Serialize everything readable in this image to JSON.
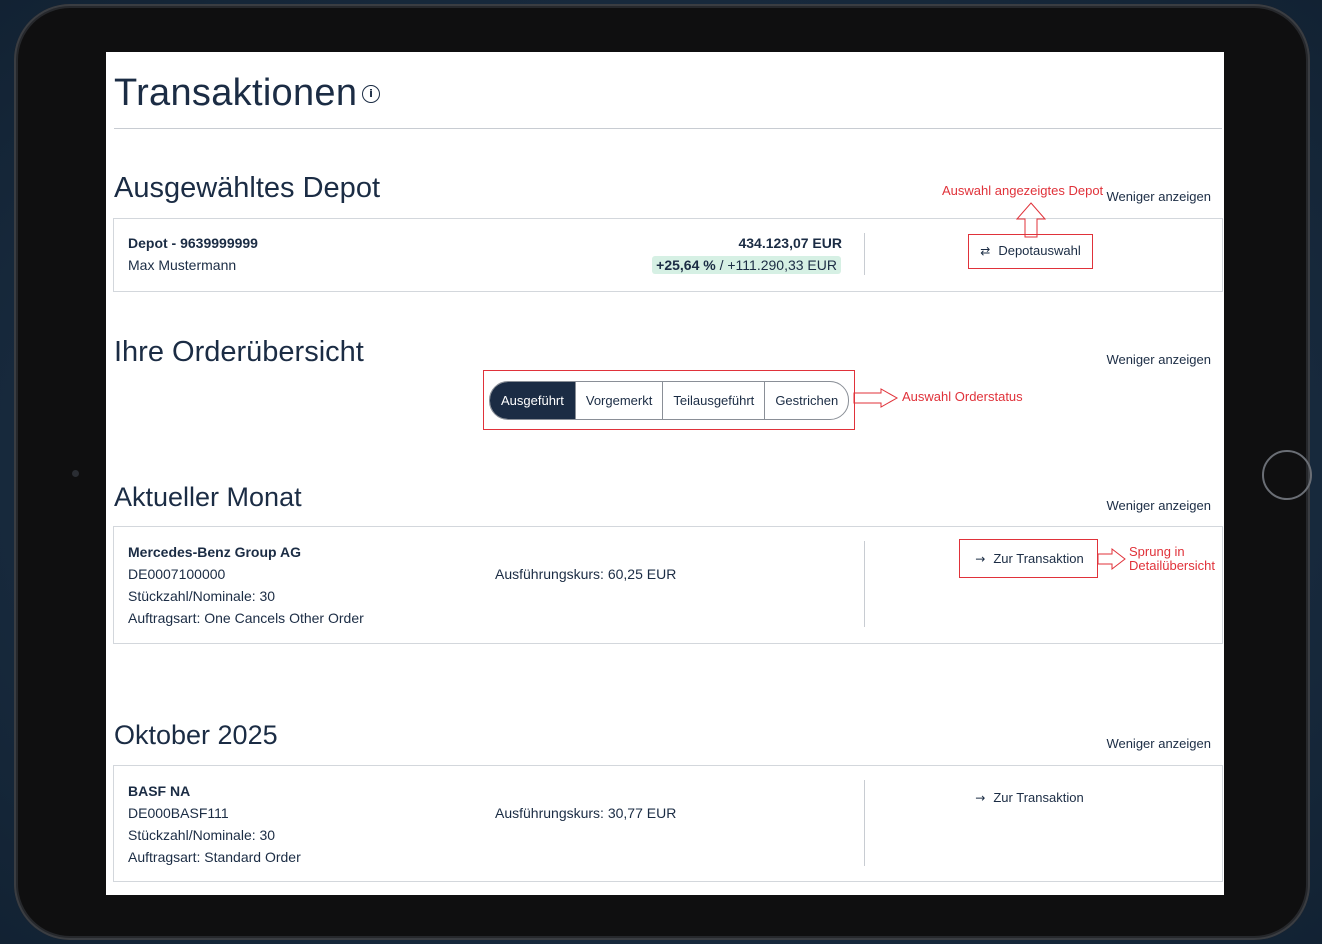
{
  "page": {
    "title": "Transaktionen",
    "info_icon": "info-icon"
  },
  "depot_section": {
    "title": "Ausgewähltes Depot",
    "less_label": "Weniger anzeigen",
    "depot_name": "Depot - 9639999999",
    "owner": "Max Mustermann",
    "value": "434.123,07 EUR",
    "perf_percent": "+25,64 %",
    "perf_separator": " / ",
    "perf_abs": "+111.290,33 EUR",
    "select_button": "Depotauswahl",
    "select_icon": "swap-arrows-icon"
  },
  "order_section": {
    "title": "Ihre Orderübersicht",
    "less_label": "Weniger anzeigen",
    "tabs": [
      {
        "label": "Ausgeführt",
        "active": true
      },
      {
        "label": "Vorgemerkt",
        "active": false
      },
      {
        "label": "Teilausgeführt",
        "active": false
      },
      {
        "label": "Gestrichen",
        "active": false
      }
    ]
  },
  "month_section": {
    "title": "Aktueller Monat",
    "less_label": "Weniger anzeigen",
    "item": {
      "name": "Mercedes-Benz Group AG",
      "isin": "DE0007100000",
      "quantity": "Stückzahl/Nominale: 30",
      "order_type": "Auftragsart: One Cancels Other Order",
      "price": "Ausführungskurs: 60,25 EUR",
      "button": "Zur Transaktion"
    }
  },
  "october_section": {
    "title": "Oktober 2025",
    "less_label": "Weniger anzeigen",
    "item": {
      "name": "BASF NA",
      "isin": "DE000BASF111",
      "quantity": "Stückzahl/Nominale: 30",
      "order_type": "Auftragsart: Standard Order",
      "price": "Ausführungskurs: 30,77 EUR",
      "button": "Zur Transaktion"
    }
  },
  "annotations": {
    "depot": "Auswahl angezeigtes Depot",
    "orderstatus": "Auswahl Orderstatus",
    "jump_line1": "Sprung in",
    "jump_line2": "Detailübersicht"
  },
  "colors": {
    "primary": "#1b2c44",
    "annotation": "#e0323a",
    "badge": "#d6f0e4"
  }
}
